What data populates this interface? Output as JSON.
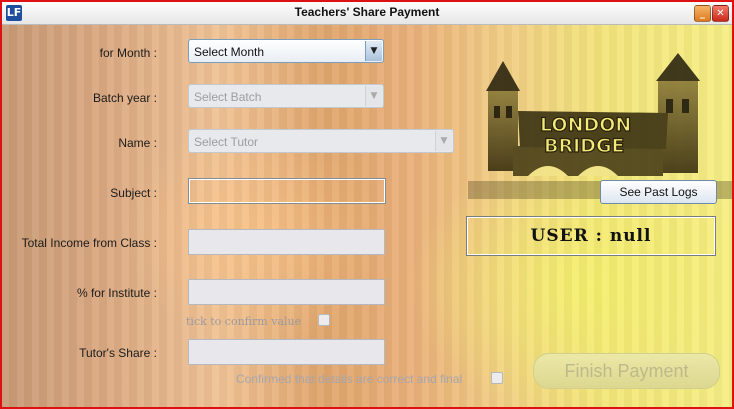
{
  "window": {
    "title": "Teachers' Share Payment",
    "app_icon": "LF",
    "minimize_glyph": "_",
    "close_glyph": "✕"
  },
  "form": {
    "month_label": "for Month :",
    "month_value": "Select Month",
    "batch_label": "Batch year :",
    "batch_value": "Select Batch",
    "name_label": "Name :",
    "name_value": "Select Tutor",
    "subject_label": "Subject :",
    "subject_value": "",
    "income_label": "Total Income from Class :",
    "income_value": "",
    "institute_label": "% for Institute :",
    "institute_value": "",
    "tick_confirm_label": "tick to confirm value",
    "tutor_share_label": "Tutor's Share :",
    "tutor_share_value": "",
    "confirm_label": "Confirmed that details are correct and final"
  },
  "side": {
    "see_past_logs": "See Past Logs",
    "user_text": "USER : null",
    "finish_label": "Finish Payment",
    "logo_line1": "LONDON",
    "logo_line2": "BRIDGE"
  },
  "icons": {
    "dropdown": "chevron-down-icon",
    "minimize": "minimize-icon",
    "close": "close-icon"
  },
  "colors": {
    "window_border": "#dd1111",
    "accent_blue": "#7b9ebd"
  }
}
